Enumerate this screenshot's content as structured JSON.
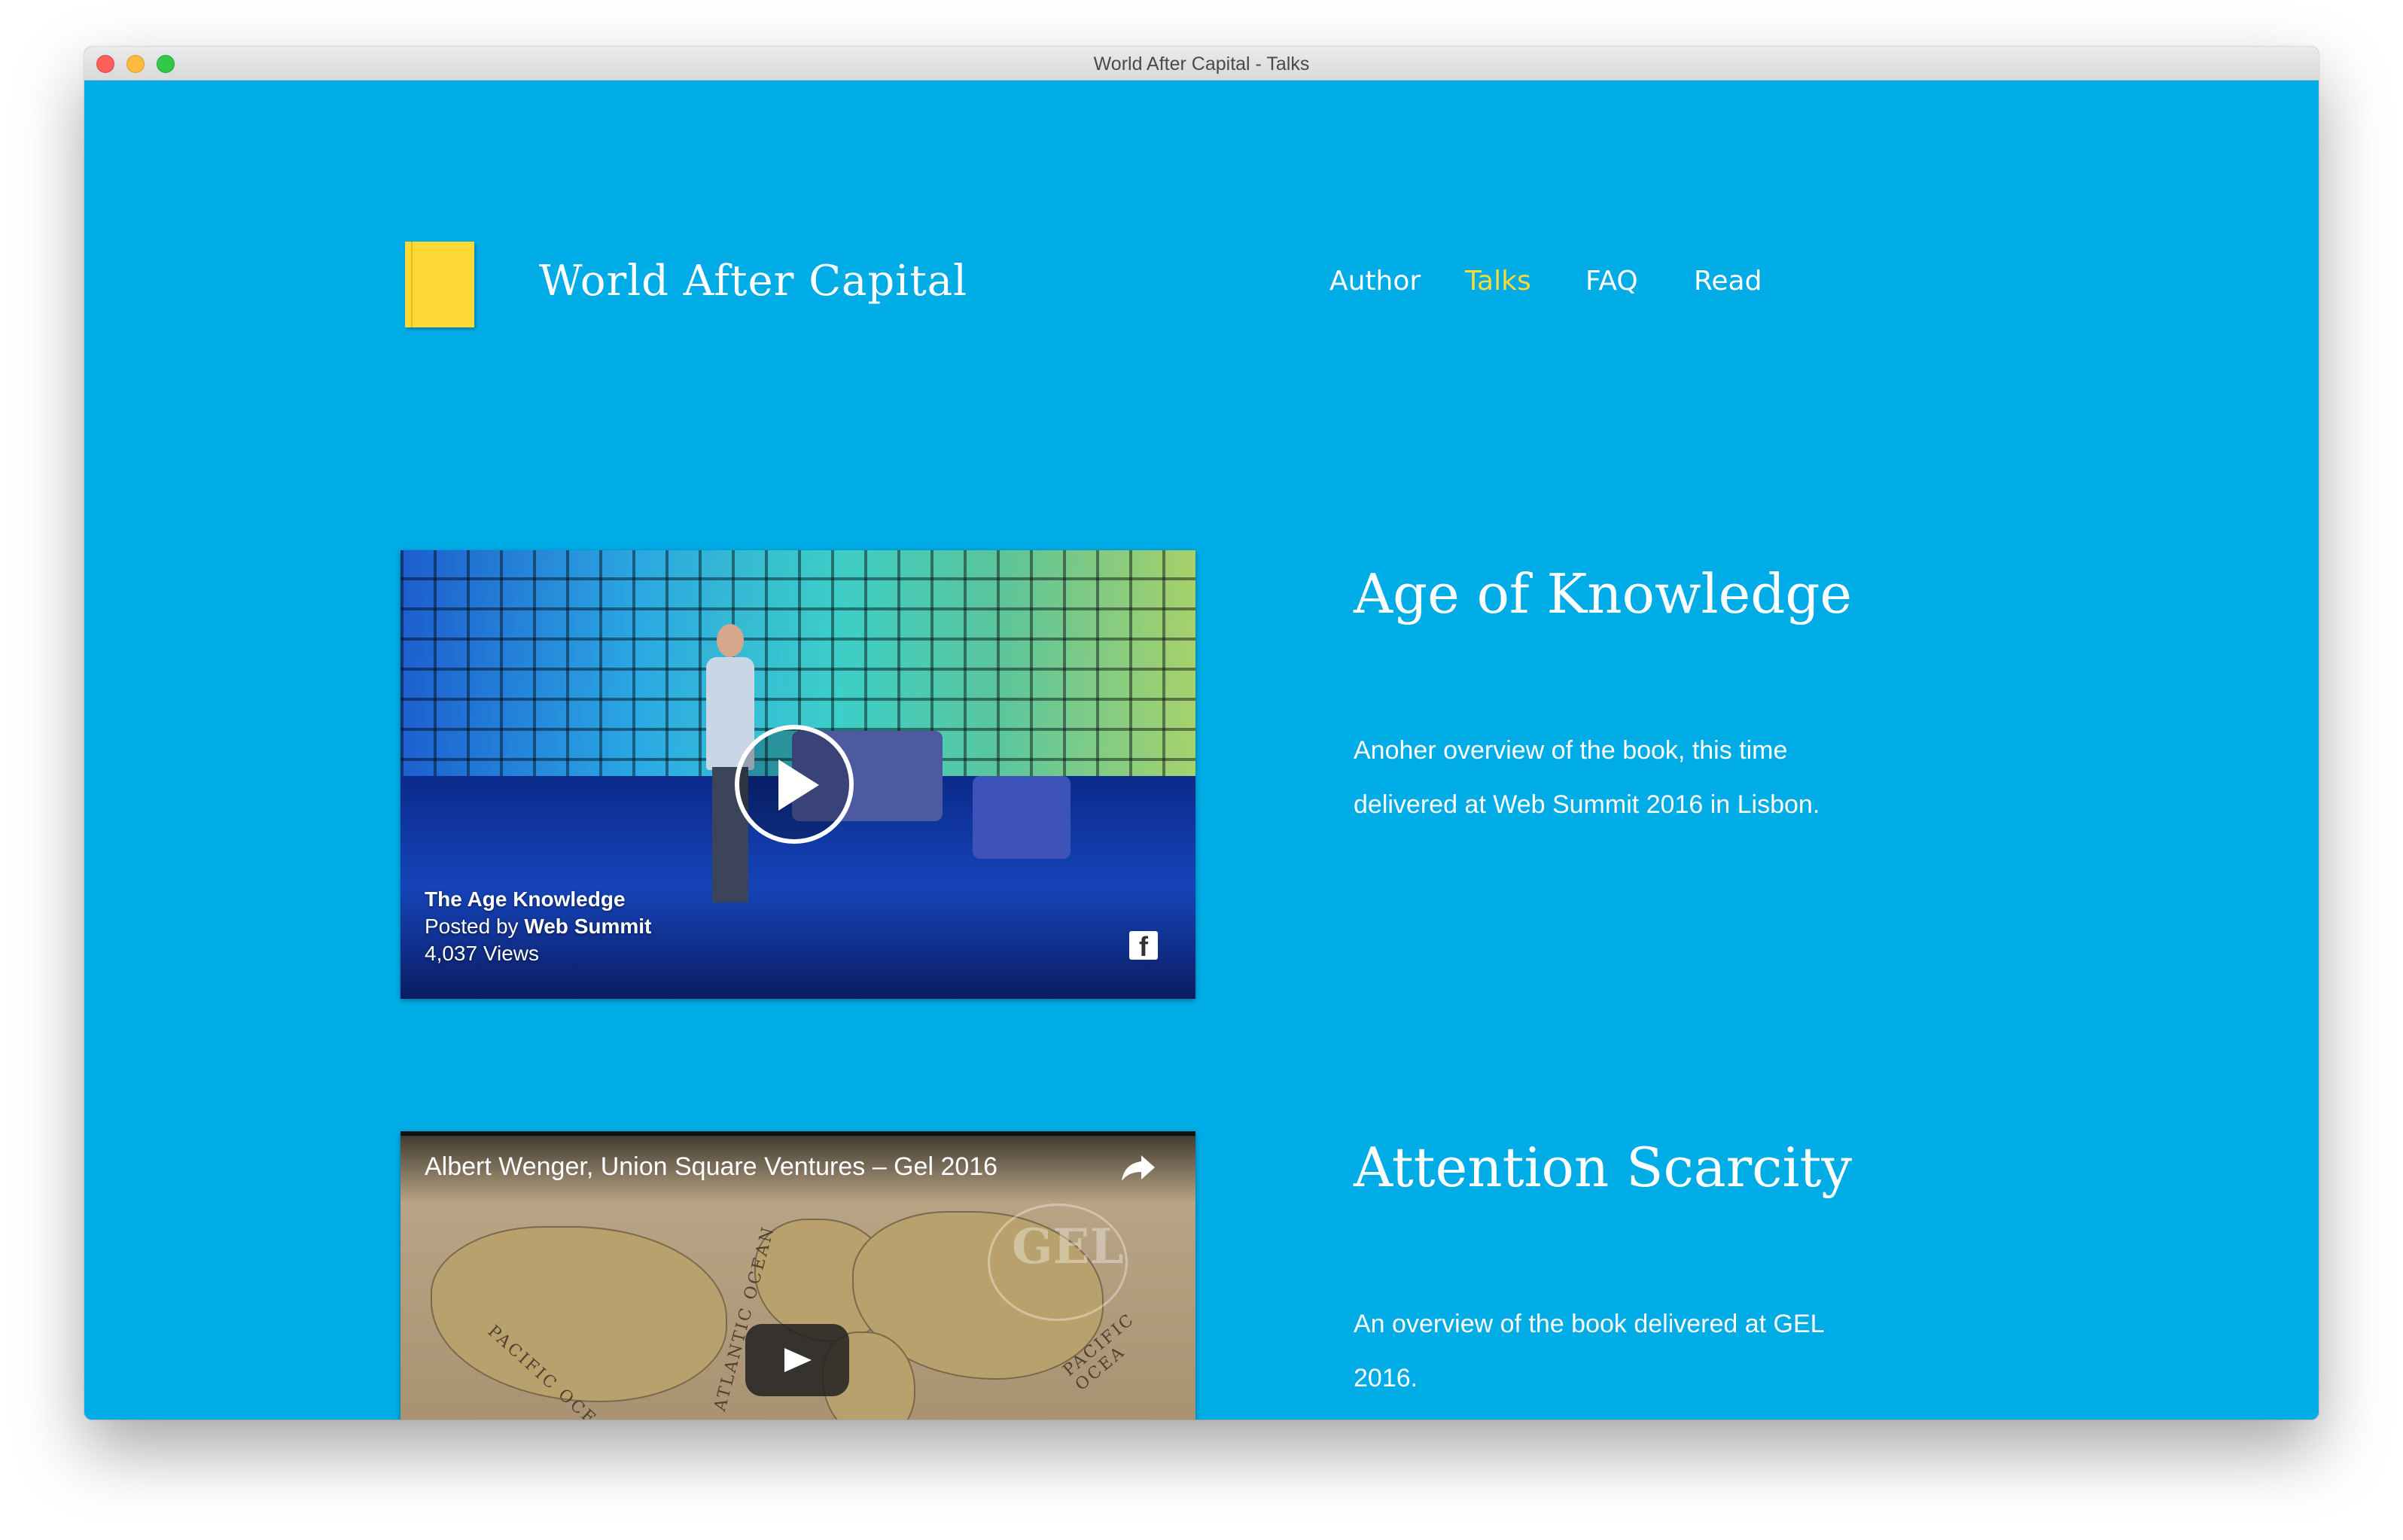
{
  "window": {
    "title": "World After Capital - Talks"
  },
  "header": {
    "site_title": "World After Capital",
    "nav": [
      {
        "label": "Author",
        "active": false
      },
      {
        "label": "Talks",
        "active": true
      },
      {
        "label": "FAQ",
        "active": false
      },
      {
        "label": "Read",
        "active": false
      }
    ]
  },
  "colors": {
    "background": "#00ace6",
    "accent": "#fcd937",
    "text": "#ffffff"
  },
  "talks": [
    {
      "title": "Age of Knowledge",
      "description": "Anoher overview of the book, this time delivered at Web Summit 2016 in Lisbon.",
      "video": {
        "provider_icon": "facebook-icon",
        "video_title": "The Age Knowledge",
        "posted_by_prefix": "Posted by",
        "posted_by": "Web Summit",
        "views": "4,037 Views"
      }
    },
    {
      "title": "Attention Scarcity",
      "description": "An overview of the book delivered at GEL 2016.",
      "video": {
        "provider_icon": "youtube-play-icon",
        "video_title": "Albert Wenger, Union Square Ventures – Gel 2016",
        "overlay_text": "GEL",
        "map_labels": [
          "PACIFIC OCEAN",
          "ATLANTIC OCEAN",
          "PACIFIC OCEA"
        ]
      }
    }
  ]
}
